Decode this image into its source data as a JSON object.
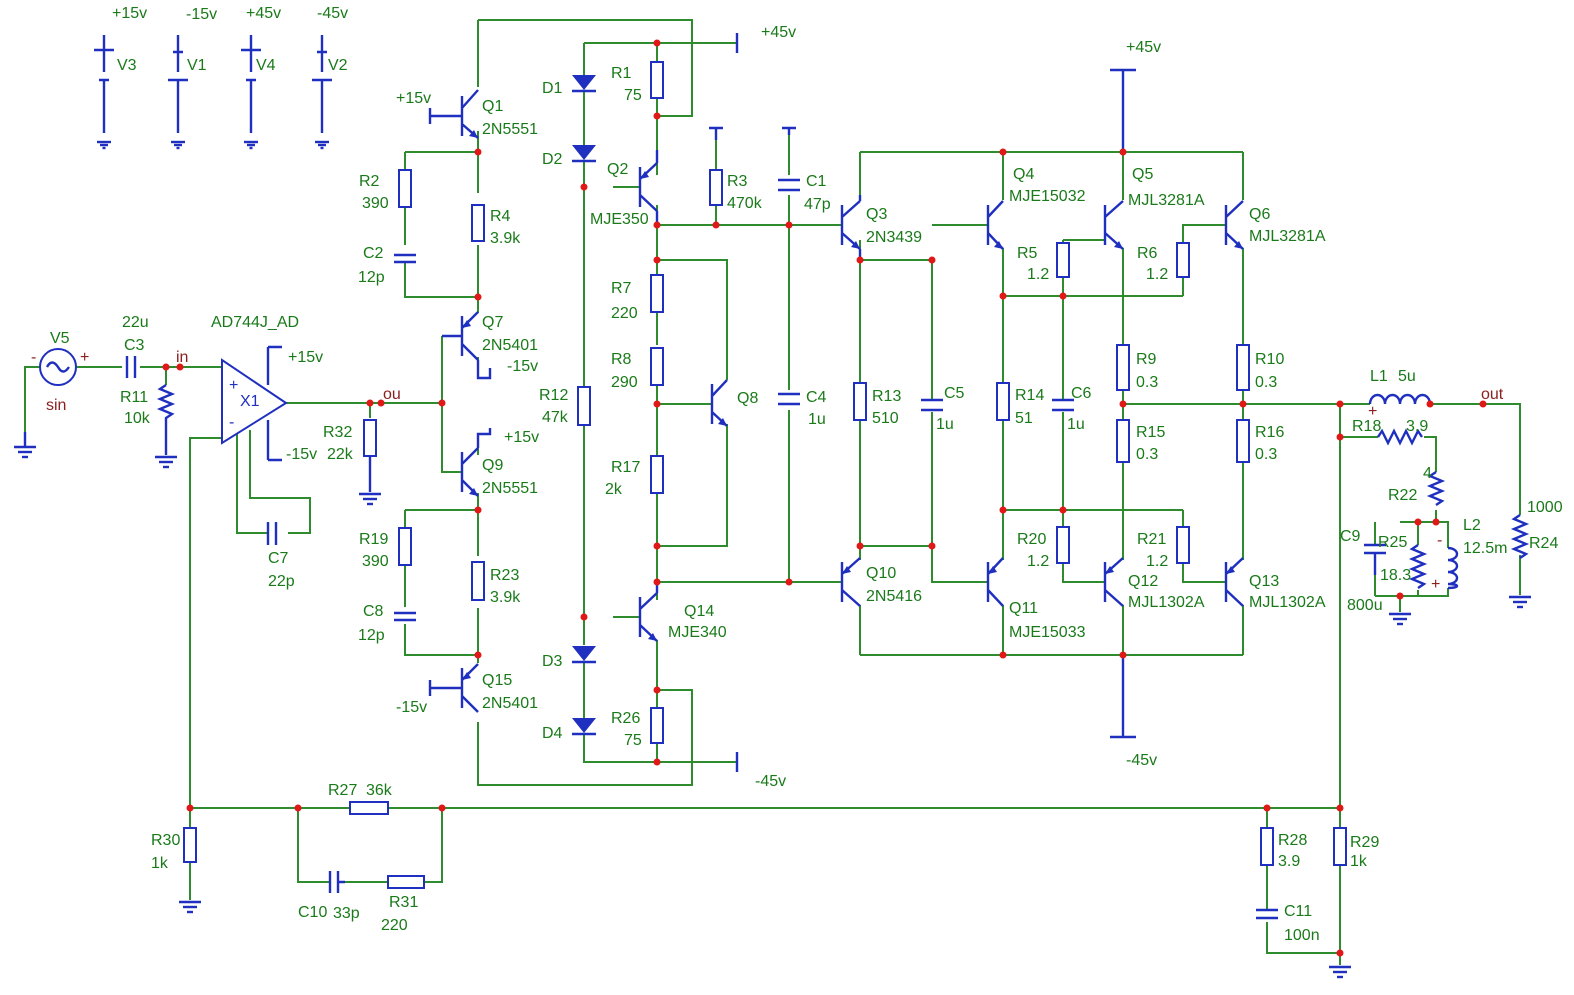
{
  "labels": {
    "supply_v3": "+15v",
    "supply_v1": "-15v",
    "supply_v4": "+45v",
    "supply_v2": "-45v",
    "V3": "V3",
    "V1": "V1",
    "V4": "V4",
    "V2": "V2",
    "V5": "V5",
    "sin": "sin",
    "C3": "C3",
    "C3_val": "22u",
    "R11": "R11",
    "R11_val": "10k",
    "net_in": "in",
    "net_ou": "ou",
    "net_out": "out",
    "X1": "X1",
    "X1_part": "AD744J_AD",
    "x1_pos": "+15v",
    "x1_neg": "-15v",
    "C7": "C7",
    "C7_val": "22p",
    "R32": "R32",
    "R32_val": "22k",
    "Q1": "Q1",
    "Q1_part": "2N5551",
    "Q1_sup": "+15v",
    "R2": "R2",
    "R2_val": "390",
    "R4": "R4",
    "R4_val": "3.9k",
    "C2": "C2",
    "C2_val": "12p",
    "Q7": "Q7",
    "Q7_part": "2N5401",
    "Q7_sup": "-15v",
    "Q9": "Q9",
    "Q9_part": "2N5551",
    "Q9_sup": "+15v",
    "R19": "R19",
    "R19_val": "390",
    "R23": "R23",
    "R23_val": "3.9k",
    "C8": "C8",
    "C8_val": "12p",
    "Q15": "Q15",
    "Q15_part": "2N5401",
    "Q15_sup": "-15v",
    "D1": "D1",
    "D2": "D2",
    "D3": "D3",
    "D4": "D4",
    "R1": "R1",
    "R1_val": "75",
    "Q2": "Q2",
    "Q2_part": "MJE350",
    "top45": "+45v",
    "bot45": "-45v",
    "R3": "R3",
    "R3_val": "470k",
    "C1": "C1",
    "C1_val": "47p",
    "R7": "R7",
    "R7_val": "220",
    "R8": "R8",
    "R8_val": "290",
    "Q8": "Q8",
    "R12": "R12",
    "R12_val": "47k",
    "R17": "R17",
    "R17_val": "2k",
    "C4": "C4",
    "C4_val": "1u",
    "Q14": "Q14",
    "Q14_part": "MJE340",
    "R26": "R26",
    "R26_val": "75",
    "Q3": "Q3",
    "Q3_part": "2N3439",
    "R13": "R13",
    "R13_val": "510",
    "C5": "C5",
    "C5_val": "1u",
    "Q10": "Q10",
    "Q10_part": "2N5416",
    "Q4": "Q4",
    "Q4_part": "MJE15032",
    "R14": "R14",
    "R14_val": "51",
    "C6": "C6",
    "C6_val": "1u",
    "Q11": "Q11",
    "Q11_part": "MJE15033",
    "R5": "R5",
    "R5_val": "1.2",
    "R20": "R20",
    "R20_val": "1.2",
    "Q5": "Q5",
    "Q5_part": "MJL3281A",
    "R6": "R6",
    "R6_val": "1.2",
    "Q6": "Q6",
    "Q6_part": "MJL3281A",
    "R9": "R9",
    "R9_val": "0.3",
    "R10": "R10",
    "R10_val": "0.3",
    "R15": "R15",
    "R15_val": "0.3",
    "R16": "R16",
    "R16_val": "0.3",
    "R21": "R21",
    "R21_val": "1.2",
    "Q12": "Q12",
    "Q12_part": "MJL1302A",
    "Q13": "Q13",
    "Q13_part": "MJL1302A",
    "rail_top": "+45v",
    "rail_bot": "-45v",
    "L1": "L1",
    "L1_val": "5u",
    "R18": "R18",
    "R18_val": "3.9",
    "R22": "R22",
    "R22_val": "4",
    "C9": "C9",
    "C9_val": "800u",
    "R25": "R25",
    "R25_val": "18.3",
    "L2": "L2",
    "L2_val": "12.5m",
    "R24": "R24",
    "R24_val": "1000",
    "R27": "R27",
    "R27_val": "36k",
    "R30": "R30",
    "R30_val": "1k",
    "C10": "C10",
    "C10_val": "33p",
    "R31": "R31",
    "R31_val": "220",
    "R28": "R28",
    "R28_val": "3.9",
    "C11": "C11",
    "C11_val": "100n",
    "R29": "R29",
    "R29_val": "1k"
  }
}
